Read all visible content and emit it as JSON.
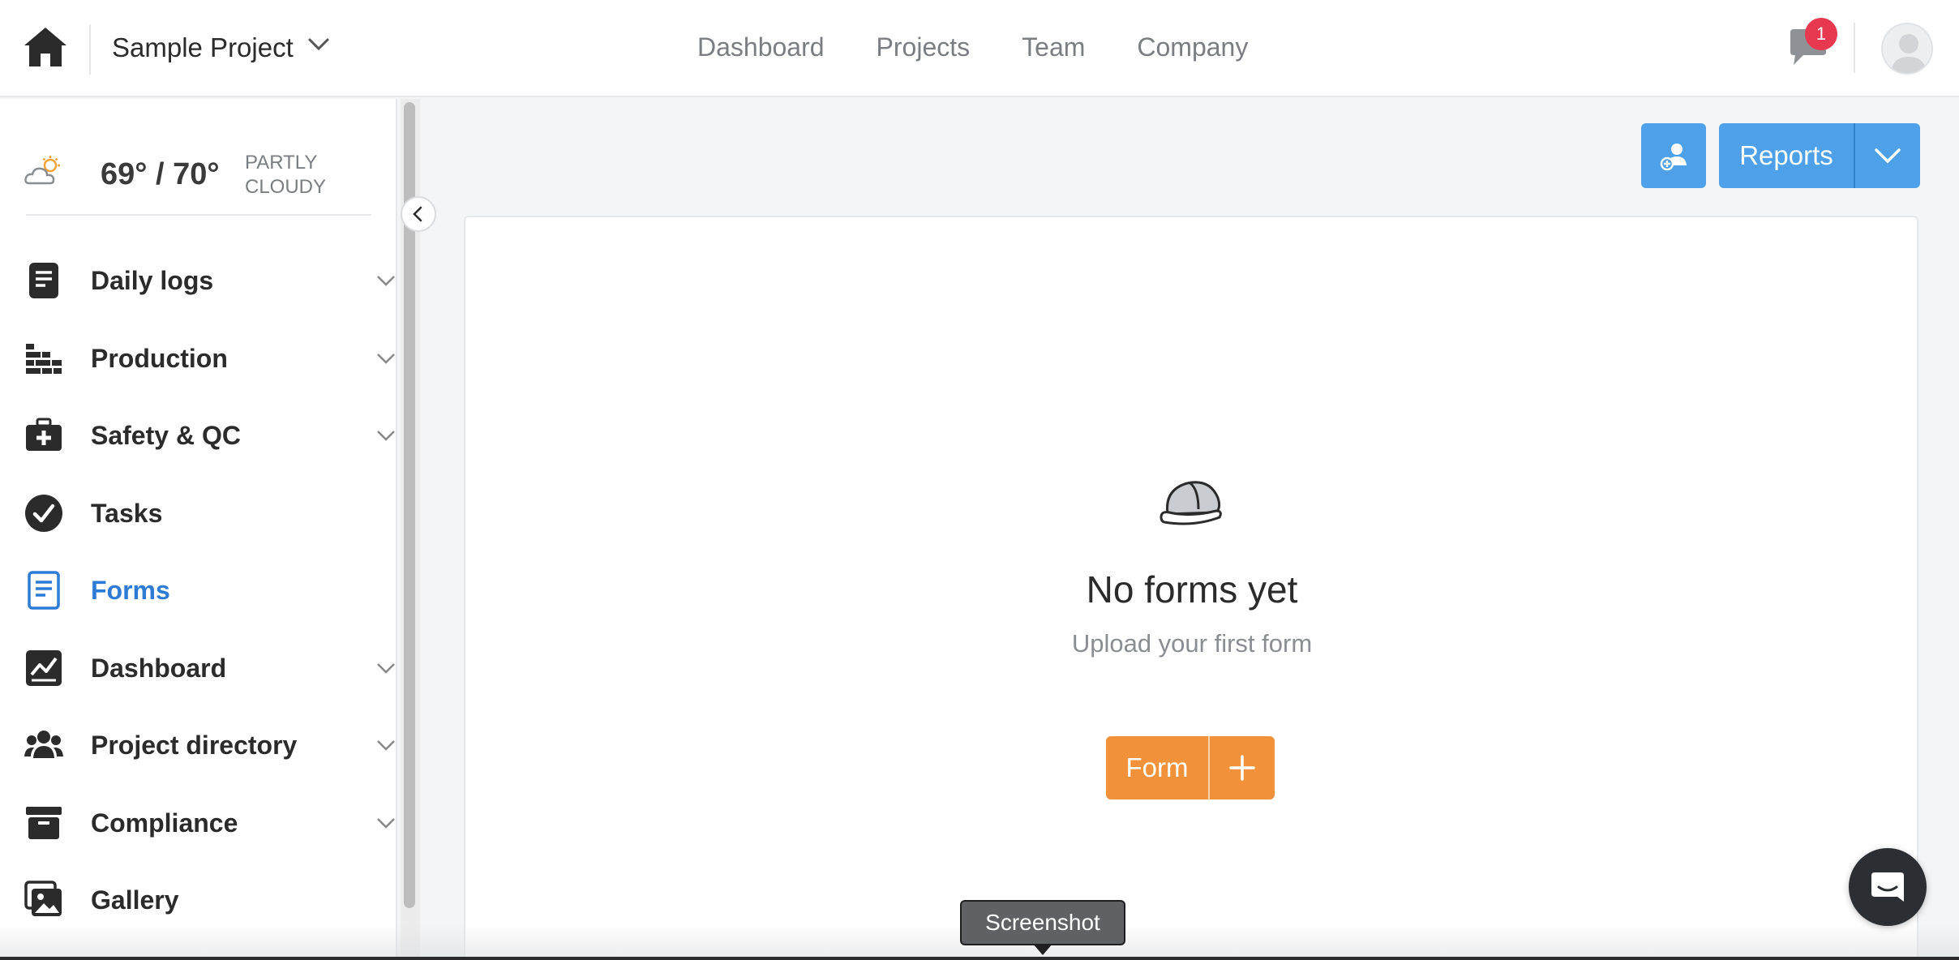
{
  "header": {
    "project_name": "Sample Project",
    "nav": [
      "Dashboard",
      "Projects",
      "Team",
      "Company"
    ],
    "notifications_count": "1"
  },
  "weather": {
    "temperature": "69° / 70°",
    "condition_line1": "PARTLY",
    "condition_line2": "CLOUDY"
  },
  "sidebar": {
    "active_item": "Forms",
    "items": [
      {
        "label": "Daily logs",
        "icon": "daily-log-icon"
      },
      {
        "label": "Production",
        "icon": "production-bricks-icon"
      },
      {
        "label": "Safety & QC",
        "icon": "first-aid-kit-icon"
      },
      {
        "label": "Tasks",
        "icon": "check-circle-icon"
      },
      {
        "label": "Forms",
        "icon": "form-document-icon"
      },
      {
        "label": "Dashboard",
        "icon": "chart-line-icon"
      },
      {
        "label": "Project directory",
        "icon": "people-group-icon"
      },
      {
        "label": "Compliance",
        "icon": "archive-box-icon"
      },
      {
        "label": "Gallery",
        "icon": "image-gallery-icon"
      }
    ]
  },
  "toolbar": {
    "reports_label": "Reports"
  },
  "empty_state": {
    "title": "No forms yet",
    "subtitle": "Upload your first form",
    "button_label": "Form",
    "icon": "hard-hat-icon"
  },
  "tooltip": {
    "text": "Screenshot"
  },
  "colors": {
    "primary_blue": "#4ea1e8",
    "accent_orange": "#f1923b",
    "active_link": "#2e7bd6",
    "badge_red": "#e8384f"
  }
}
